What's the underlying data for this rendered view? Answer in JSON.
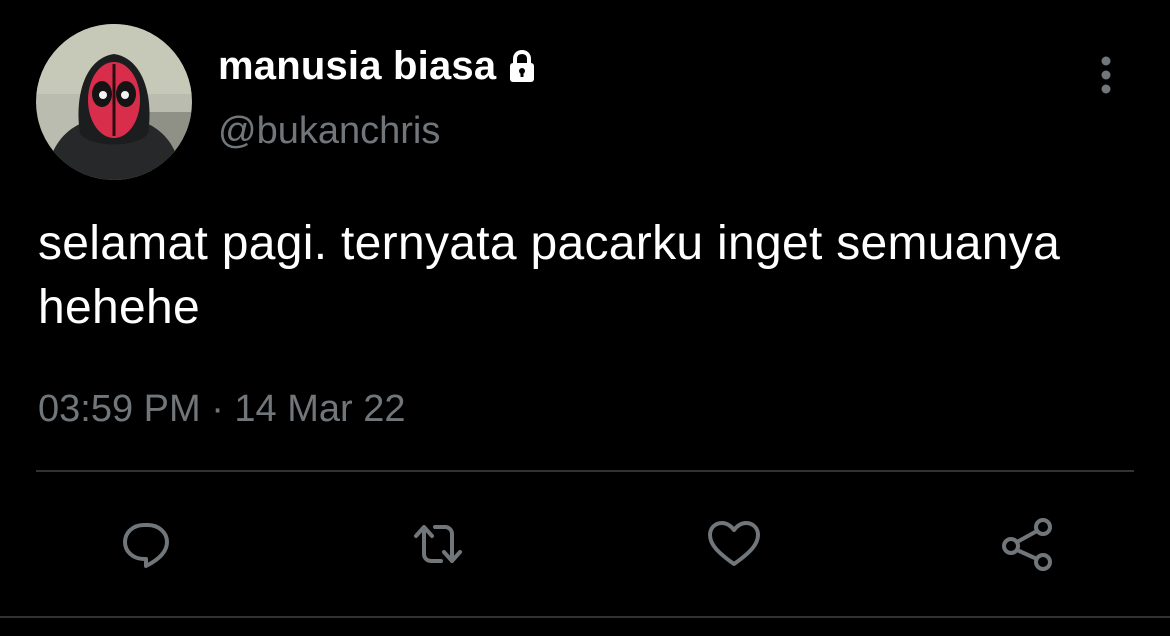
{
  "tweet": {
    "display_name": "manusia biasa",
    "handle": "@bukanchris",
    "text": "selamat pagi. ternyata pacarku inget semuanya hehehe",
    "timestamp": "03:59 PM · 14 Mar 22",
    "protected_icon": "lock-icon",
    "more_icon": "more-vertical-icon"
  },
  "actions": [
    {
      "name": "reply",
      "icon": "comment-icon"
    },
    {
      "name": "retweet",
      "icon": "retweet-icon"
    },
    {
      "name": "like",
      "icon": "heart-icon"
    },
    {
      "name": "share",
      "icon": "share-icon"
    }
  ],
  "colors": {
    "background": "#000000",
    "primary_text": "#ffffff",
    "secondary_text": "#71767b",
    "divider": "#2f3336",
    "icon": "#71767b"
  }
}
